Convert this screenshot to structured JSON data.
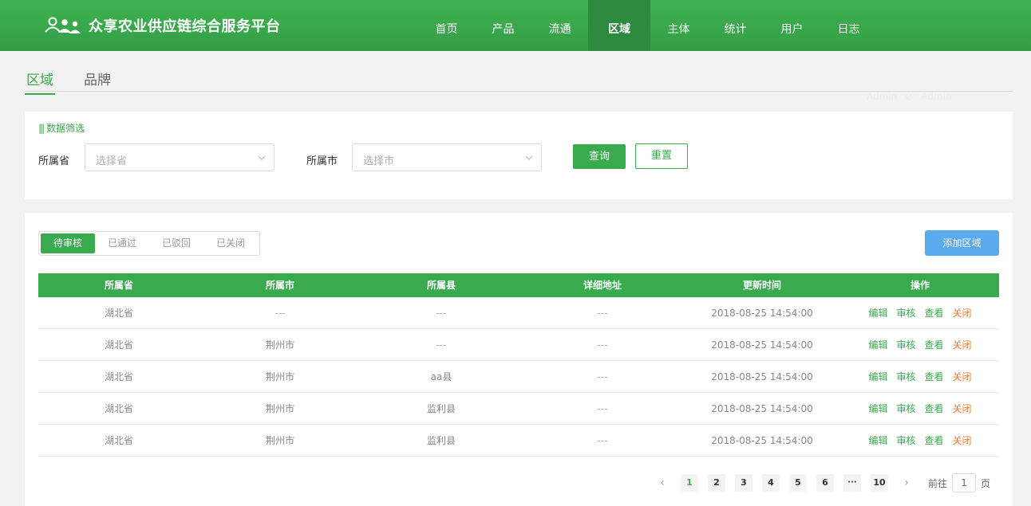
{
  "app": {
    "title": "众享农业供应链综合服务平台",
    "logo_icon": "people-group-icon"
  },
  "nav": [
    {
      "label": "首页",
      "active": false
    },
    {
      "label": "产品",
      "active": false
    },
    {
      "label": "流通",
      "active": false
    },
    {
      "label": "区域",
      "active": true
    },
    {
      "label": "主体",
      "active": false
    },
    {
      "label": "统计",
      "active": false
    },
    {
      "label": "用户",
      "active": false
    },
    {
      "label": "日志",
      "active": false
    }
  ],
  "page_tabs": [
    {
      "label": "区域",
      "active": true
    },
    {
      "label": "品牌",
      "active": false
    }
  ],
  "faint_user": {
    "left": "Admin",
    "right": "Admin"
  },
  "filter": {
    "title": "数据筛选",
    "province_label": "所属省",
    "province_placeholder": "选择省",
    "city_label": "所属市",
    "city_placeholder": "选择市",
    "query_label": "查询",
    "reset_label": "重置"
  },
  "status_tabs": [
    {
      "label": "待审核",
      "active": true
    },
    {
      "label": "已通过",
      "active": false
    },
    {
      "label": "已驳回",
      "active": false
    },
    {
      "label": "已关闭",
      "active": false
    }
  ],
  "add_button": "添加区域",
  "table": {
    "headers": [
      "所属省",
      "所属市",
      "所属县",
      "详细地址",
      "更新时间",
      "操作"
    ],
    "actions": [
      "编辑",
      "审核",
      "查看",
      "关闭"
    ],
    "rows": [
      {
        "province": "湖北省",
        "city": "---",
        "county": "---",
        "address": "---",
        "updated": "2018-08-25 14:54:00"
      },
      {
        "province": "湖北省",
        "city": "荆州市",
        "county": "---",
        "address": "---",
        "updated": "2018-08-25 14:54:00"
      },
      {
        "province": "湖北省",
        "city": "荆州市",
        "county": "aa县",
        "address": "---",
        "updated": "2018-08-25 14:54:00"
      },
      {
        "province": "湖北省",
        "city": "荆州市",
        "county": "监利县",
        "address": "---",
        "updated": "2018-08-25 14:54:00"
      },
      {
        "province": "湖北省",
        "city": "荆州市",
        "county": "监利县",
        "address": "---",
        "updated": "2018-08-25 14:54:00"
      }
    ]
  },
  "pagination": {
    "prev": "‹",
    "pages": [
      "1",
      "2",
      "3",
      "4",
      "5",
      "6"
    ],
    "more": "···",
    "last": "10",
    "next": "›",
    "current": "1",
    "goto_prefix": "前往",
    "goto_value": "1",
    "goto_suffix": "页"
  },
  "colors": {
    "primary": "#3aaa4f",
    "nav_active": "#2d8a3f",
    "add_button": "#5aaaee",
    "close_action": "#f07b2a"
  }
}
